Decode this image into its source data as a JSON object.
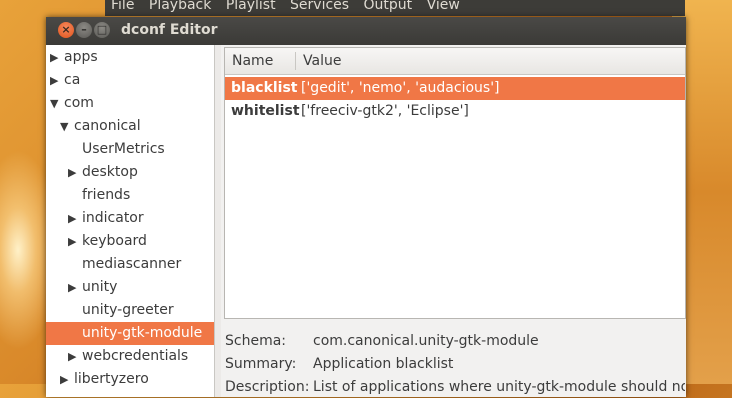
{
  "background_app": {
    "menu": [
      "File",
      "Playback",
      "Playlist",
      "Services",
      "Output",
      "View"
    ]
  },
  "window": {
    "title": "dconf Editor",
    "close_symbol": "×",
    "minimize_symbol": "–",
    "maximize_symbol": "□"
  },
  "tree": {
    "items": [
      {
        "label": "apps",
        "arrow": "▶",
        "depth": 0
      },
      {
        "label": "ca",
        "arrow": "▶",
        "depth": 0
      },
      {
        "label": "com",
        "arrow": "▼",
        "depth": 0
      },
      {
        "label": "canonical",
        "arrow": "▼",
        "depth": 1
      },
      {
        "label": "UserMetrics",
        "arrow": "",
        "depth": 2
      },
      {
        "label": "desktop",
        "arrow": "▶",
        "depth": 2
      },
      {
        "label": "friends",
        "arrow": "",
        "depth": 2
      },
      {
        "label": "indicator",
        "arrow": "▶",
        "depth": 2
      },
      {
        "label": "keyboard",
        "arrow": "▶",
        "depth": 2
      },
      {
        "label": "mediascanner",
        "arrow": "",
        "depth": 2
      },
      {
        "label": "unity",
        "arrow": "▶",
        "depth": 2
      },
      {
        "label": "unity-greeter",
        "arrow": "",
        "depth": 2
      },
      {
        "label": "unity-gtk-module",
        "arrow": "",
        "depth": 2,
        "selected": true
      },
      {
        "label": "webcredentials",
        "arrow": "▶",
        "depth": 2
      },
      {
        "label": "libertyzero",
        "arrow": "▶",
        "depth": 1
      }
    ]
  },
  "list": {
    "columns": [
      "Name",
      "Value"
    ],
    "rows": [
      {
        "name": "blacklist",
        "value": "['gedit', 'nemo', 'audacious']",
        "selected": true
      },
      {
        "name": "whitelist",
        "value": "['freeciv-gtk2', 'Eclipse']",
        "selected": false
      }
    ]
  },
  "details": {
    "schema_label": "Schema:",
    "schema_value": "com.canonical.unity-gtk-module",
    "summary_label": "Summary:",
    "summary_value": "Application blacklist",
    "description_label": "Description:",
    "description_value": "List of applications where unity-gtk-module should not be loaded"
  },
  "colors": {
    "selection": "#f07746",
    "titlebar": "#3b3a37"
  }
}
